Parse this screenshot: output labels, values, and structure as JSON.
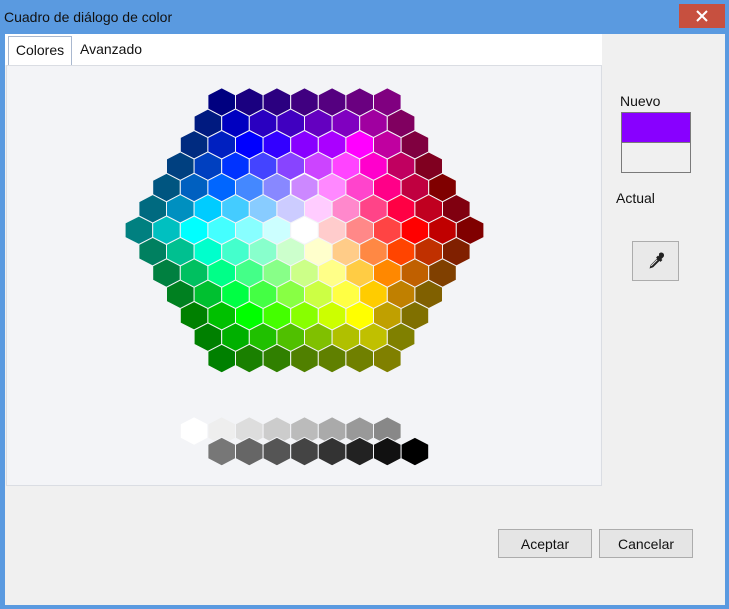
{
  "window": {
    "title": "Cuadro de diálogo de color"
  },
  "tabs": [
    {
      "label": "Colores",
      "active": true
    },
    {
      "label": "Avanzado",
      "active": false
    }
  ],
  "preview": {
    "new_label": "Nuevo",
    "current_label": "Actual",
    "new_color": "#8800ff",
    "current_color": "#f0f0f0"
  },
  "buttons": {
    "ok_label": "Aceptar",
    "cancel_label": "Cancelar"
  },
  "colors": {
    "close_button": "#c7503f",
    "titlebar": "#5a9ae0"
  },
  "palette": {
    "selected": [
      4,
      5
    ],
    "rows": [
      [
        "#000080",
        "#1a0080",
        "#2b0080",
        "#400080",
        "#550080",
        "#6a0080",
        "#800080"
      ],
      [
        "#001a80",
        "#0000c0",
        "#2a00c0",
        "#4000c0",
        "#6400c0",
        "#8000c0",
        "#a000a0",
        "#800060"
      ],
      [
        "#002b80",
        "#0020c0",
        "#0000ff",
        "#3300ff",
        "#8800ff",
        "#aa00ff",
        "#ff00ff",
        "#c000a0",
        "#800040"
      ],
      [
        "#004080",
        "#0040c0",
        "#0033ff",
        "#4444ff",
        "#8844ff",
        "#cc44ff",
        "#ff44ff",
        "#ff00cc",
        "#c00060",
        "#800020"
      ],
      [
        "#005580",
        "#0060c0",
        "#0066ff",
        "#4488ff",
        "#8888ff",
        "#cc88ff",
        "#ff88ff",
        "#ff44cc",
        "#ff0088",
        "#c00040",
        "#800000"
      ],
      [
        "#006a80",
        "#0090c0",
        "#00ccff",
        "#44ccff",
        "#88ccff",
        "#ccccff",
        "#ffccff",
        "#ff88cc",
        "#ff4488",
        "#ff0044",
        "#c00020",
        "#800010"
      ],
      [
        "#008080",
        "#00c0c0",
        "#00ffff",
        "#44ffff",
        "#88ffff",
        "#ccffff",
        "#ffffff",
        "#ffcccc",
        "#ff8888",
        "#ff4444",
        "#ff0000",
        "#c00000",
        "#800000"
      ],
      [
        "#008060",
        "#00c090",
        "#00ffcc",
        "#44ffcc",
        "#88ffcc",
        "#ccffcc",
        "#ffffcc",
        "#ffcc88",
        "#ff8844",
        "#ff4400",
        "#c03000",
        "#802000"
      ],
      [
        "#008040",
        "#00c060",
        "#00ff88",
        "#44ff88",
        "#88ff88",
        "#ccff88",
        "#ffff88",
        "#ffcc44",
        "#ff8800",
        "#c06000",
        "#804000"
      ],
      [
        "#008020",
        "#00c030",
        "#00ff44",
        "#44ff44",
        "#88ff44",
        "#ccff44",
        "#ffff44",
        "#ffcc00",
        "#c08000",
        "#806000"
      ],
      [
        "#008000",
        "#00c000",
        "#00ff00",
        "#44ff00",
        "#88ff00",
        "#ccff00",
        "#ffff00",
        "#c0a000",
        "#807000"
      ],
      [
        "#008000",
        "#00b000",
        "#20c000",
        "#50c000",
        "#80c000",
        "#b0c000",
        "#c0c000",
        "#808000"
      ],
      [
        "#008000",
        "#1a8000",
        "#308000",
        "#508000",
        "#608000",
        "#708000",
        "#808000"
      ]
    ],
    "greys_top": [
      "#ffffff",
      "#eeeeee",
      "#dddddd",
      "#cccccc",
      "#bbbbbb",
      "#aaaaaa",
      "#999999",
      "#888888"
    ],
    "greys_bottom": [
      "#777777",
      "#666666",
      "#555555",
      "#444444",
      "#333333",
      "#222222",
      "#111111",
      "#000000"
    ]
  }
}
